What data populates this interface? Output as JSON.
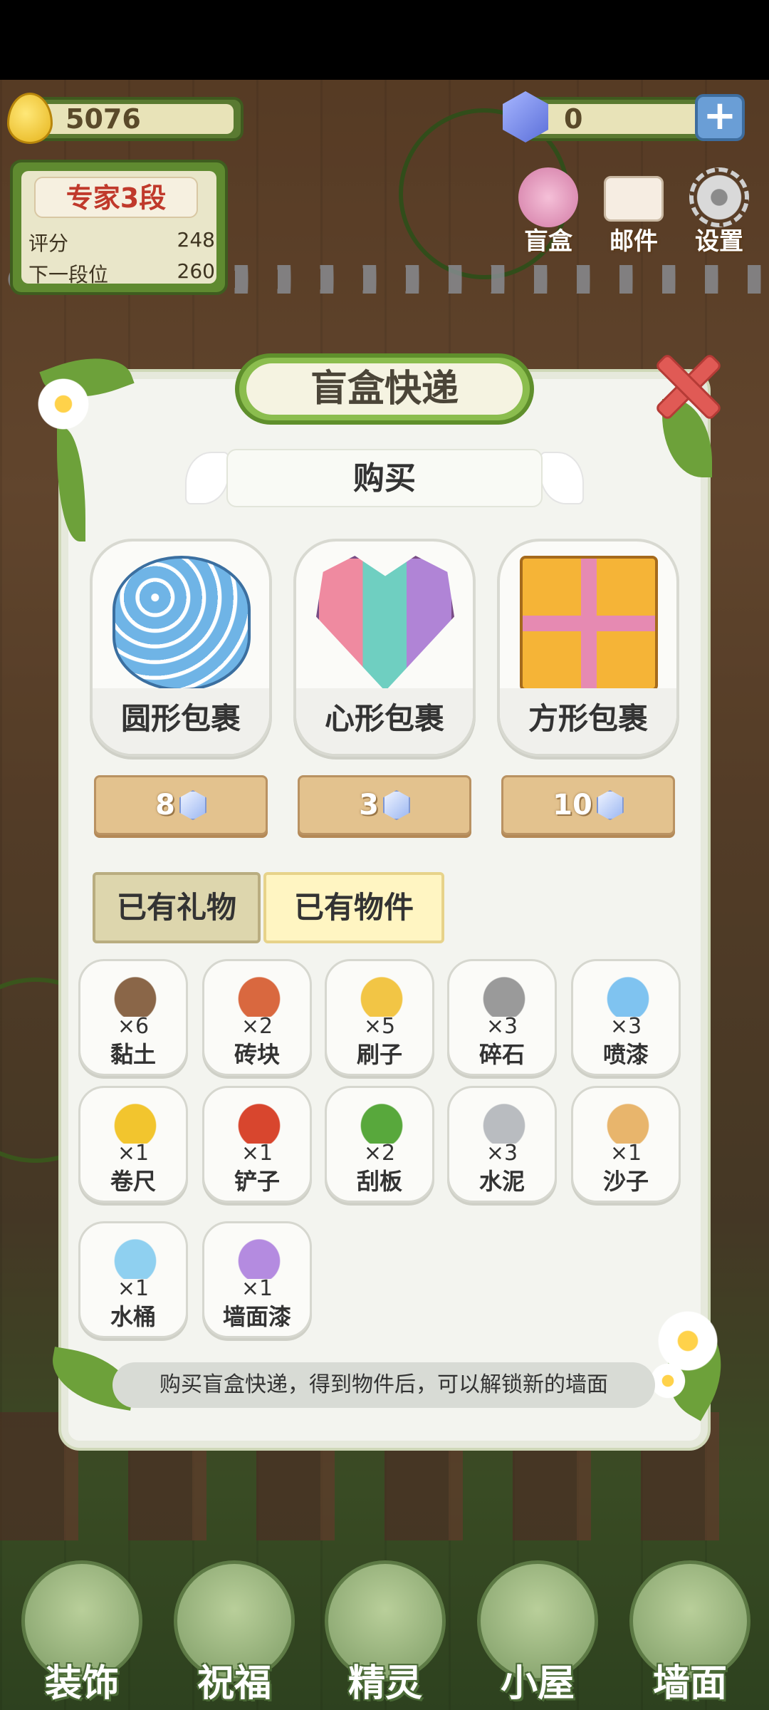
{
  "hud": {
    "gold": "5076",
    "gems": "0",
    "plus": "+"
  },
  "rank": {
    "title": "专家3段",
    "score_label": "评分",
    "score_value": "248",
    "next_label": "下一段位",
    "next_value": "260"
  },
  "top_buttons": {
    "blind_box": "盲盒",
    "mail": "邮件",
    "settings": "设置"
  },
  "modal": {
    "title": "盲盒快递",
    "buy_label": "购买",
    "packages": [
      {
        "name": "圆形包裹",
        "price": "8"
      },
      {
        "name": "心形包裹",
        "price": "3"
      },
      {
        "name": "方形包裹",
        "price": "10"
      }
    ],
    "tabs": {
      "gifts": "已有礼物",
      "items": "已有物件"
    },
    "items": [
      {
        "name": "黏土",
        "count": "×6",
        "icon": "clay-icon",
        "color": "#8a6648"
      },
      {
        "name": "砖块",
        "count": "×2",
        "icon": "bricks-icon",
        "color": "#d9683f"
      },
      {
        "name": "刷子",
        "count": "×5",
        "icon": "brush-icon",
        "color": "#f2c545"
      },
      {
        "name": "碎石",
        "count": "×3",
        "icon": "gravel-icon",
        "color": "#9a9a9a"
      },
      {
        "name": "喷漆",
        "count": "×3",
        "icon": "spray-paint-icon",
        "color": "#7fc3f0"
      },
      {
        "name": "卷尺",
        "count": "×1",
        "icon": "tape-measure-icon",
        "color": "#f2c52e"
      },
      {
        "name": "铲子",
        "count": "×1",
        "icon": "shovel-icon",
        "color": "#d8462e"
      },
      {
        "name": "刮板",
        "count": "×2",
        "icon": "scraper-icon",
        "color": "#58a83c"
      },
      {
        "name": "水泥",
        "count": "×3",
        "icon": "cement-icon",
        "color": "#b9bcc0"
      },
      {
        "name": "沙子",
        "count": "×1",
        "icon": "sand-icon",
        "color": "#e8b56c"
      },
      {
        "name": "水桶",
        "count": "×1",
        "icon": "water-bucket-icon",
        "color": "#8fd0f0"
      },
      {
        "name": "墙面漆",
        "count": "×1",
        "icon": "wall-paint-icon",
        "color": "#b48be0"
      }
    ],
    "hint": "购买盲盒快递，得到物件后，可以解锁新的墙面"
  },
  "bottom_nav": [
    {
      "label": "装饰",
      "icon": "plant-icon"
    },
    {
      "label": "祝福",
      "icon": "vase-icon"
    },
    {
      "label": "精灵",
      "icon": "fairy-icon"
    },
    {
      "label": "小屋",
      "icon": "house-icon"
    },
    {
      "label": "墙面",
      "icon": "bell-icon"
    }
  ]
}
